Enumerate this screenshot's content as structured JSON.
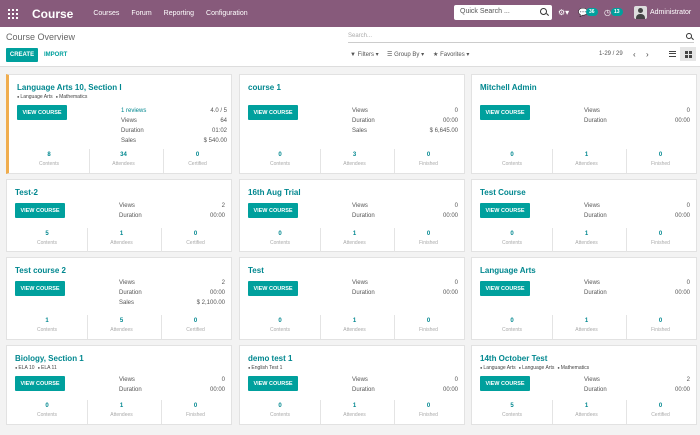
{
  "topbar": {
    "app_name": "Course",
    "menu": [
      "Courses",
      "Forum",
      "Reporting",
      "Configuration"
    ],
    "quick_search": "Quick Search ...",
    "activity_icon": "clock-gear-icon",
    "chat_count": "36",
    "activity_count": "13",
    "user": "Administrator"
  },
  "controls": {
    "breadcrumb": "Course Overview",
    "search_placeholder": "Search...",
    "create_label": "CREATE",
    "import_label": "IMPORT",
    "filters_label": "Filters",
    "groupby_label": "Group By",
    "favorites_label": "Favorites",
    "pager": "1-29 / 29"
  },
  "labels": {
    "view_course": "VIEW COURSE",
    "contents": "Contents",
    "attendees": "Attendees",
    "certified": "Certified",
    "finished": "Finished"
  },
  "colors": {
    "brand": "#875a7b",
    "accent": "#00a09d",
    "highlight": "#f0ad4e"
  },
  "cards": [
    {
      "title": "Language Arts 10, Section I",
      "tags": [
        "Language Arts",
        "Mathematics"
      ],
      "stats": [
        [
          "1 reviews",
          "4.0 / 5"
        ],
        [
          "Views",
          "64"
        ],
        [
          "Duration",
          "01:02"
        ],
        [
          "Sales",
          "$ 540.00"
        ]
      ],
      "footer": [
        "8",
        "34",
        "0"
      ],
      "third": "Certified"
    },
    {
      "title": "course 1",
      "tags": [],
      "stats": [
        [
          "Views",
          "0"
        ],
        [
          "Duration",
          "00:00"
        ],
        [
          "Sales",
          "$ 6,645.00"
        ]
      ],
      "footer": [
        "0",
        "3",
        "0"
      ],
      "third": "Finished"
    },
    {
      "title": "Mitchell Admin",
      "tags": [],
      "stats": [
        [
          "Views",
          "0"
        ],
        [
          "Duration",
          "00:00"
        ]
      ],
      "footer": [
        "0",
        "1",
        "0"
      ],
      "third": "Finished"
    },
    {
      "title": "Test-2",
      "tags": [],
      "stats": [
        [
          "Views",
          "2"
        ],
        [
          "Duration",
          "00:00"
        ]
      ],
      "footer": [
        "5",
        "1",
        "0"
      ],
      "third": "Certified"
    },
    {
      "title": "16th Aug Trial",
      "tags": [],
      "stats": [
        [
          "Views",
          "0"
        ],
        [
          "Duration",
          "00:00"
        ]
      ],
      "footer": [
        "0",
        "1",
        "0"
      ],
      "third": "Finished"
    },
    {
      "title": "Test Course",
      "tags": [],
      "stats": [
        [
          "Views",
          "0"
        ],
        [
          "Duration",
          "00:00"
        ]
      ],
      "footer": [
        "0",
        "1",
        "0"
      ],
      "third": "Finished"
    },
    {
      "title": "Test course 2",
      "tags": [],
      "stats": [
        [
          "Views",
          "2"
        ],
        [
          "Duration",
          "00:00"
        ],
        [
          "Sales",
          "$ 2,100.00"
        ]
      ],
      "footer": [
        "1",
        "5",
        "0"
      ],
      "third": "Certified"
    },
    {
      "title": "Test",
      "tags": [],
      "stats": [
        [
          "Views",
          "0"
        ],
        [
          "Duration",
          "00:00"
        ]
      ],
      "footer": [
        "0",
        "1",
        "0"
      ],
      "third": "Finished"
    },
    {
      "title": "Language Arts",
      "tags": [],
      "stats": [
        [
          "Views",
          "0"
        ],
        [
          "Duration",
          "00:00"
        ]
      ],
      "footer": [
        "0",
        "1",
        "0"
      ],
      "third": "Finished"
    },
    {
      "title": "Biology, Section 1",
      "tags": [
        "ELA 10",
        "ELA 11"
      ],
      "stats": [
        [
          "Views",
          "0"
        ],
        [
          "Duration",
          "00:00"
        ]
      ],
      "footer": [
        "0",
        "1",
        "0"
      ],
      "third": "Finished"
    },
    {
      "title": "demo test 1",
      "tags": [
        "English Test 1"
      ],
      "stats": [
        [
          "Views",
          "0"
        ],
        [
          "Duration",
          "00:00"
        ]
      ],
      "footer": [
        "0",
        "1",
        "0"
      ],
      "third": "Finished"
    },
    {
      "title": "14th October Test",
      "tags": [
        "Language Arts",
        "Language Arts",
        "Mathematics"
      ],
      "stats": [
        [
          "Views",
          "2"
        ],
        [
          "Duration",
          "00:00"
        ]
      ],
      "footer": [
        "5",
        "1",
        "0"
      ],
      "third": "Certified"
    }
  ]
}
